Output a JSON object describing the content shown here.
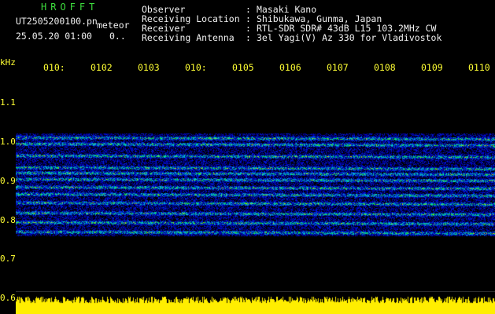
{
  "header": {
    "station": "HROFFT",
    "filename": "UT2505200100.pn",
    "mode": "meteor",
    "datetime": "25.05.20 01:00",
    "count": "0..",
    "fields": [
      {
        "label": "Observer",
        "value": "Masaki Kano"
      },
      {
        "label": "Receiving Location",
        "value": "Shibukawa, Gunma, Japan"
      },
      {
        "label": "Receiver",
        "value": "RTL-SDR SDR# 43dB L15 103.2MHz CW"
      },
      {
        "label": "Receiving Antenna",
        "value": "3el Yagi(V) Az 330 for Vladivostok"
      }
    ]
  },
  "axis": {
    "y_unit": "kHz",
    "y_ticks": [
      "1.1",
      "1.0",
      "0.9",
      "0.8",
      "0.7",
      "0.6"
    ],
    "x_ticks": [
      "010:",
      "0102",
      "0103",
      "010:",
      "0105",
      "0106",
      "0107",
      "0108",
      "0109",
      "0110"
    ]
  },
  "colors": {
    "background": "#000000",
    "label_text": "#f0f0f0",
    "axis_text": "#ffff33",
    "station_text": "#3ddc3d",
    "noise_floor": "#ffee00"
  }
}
